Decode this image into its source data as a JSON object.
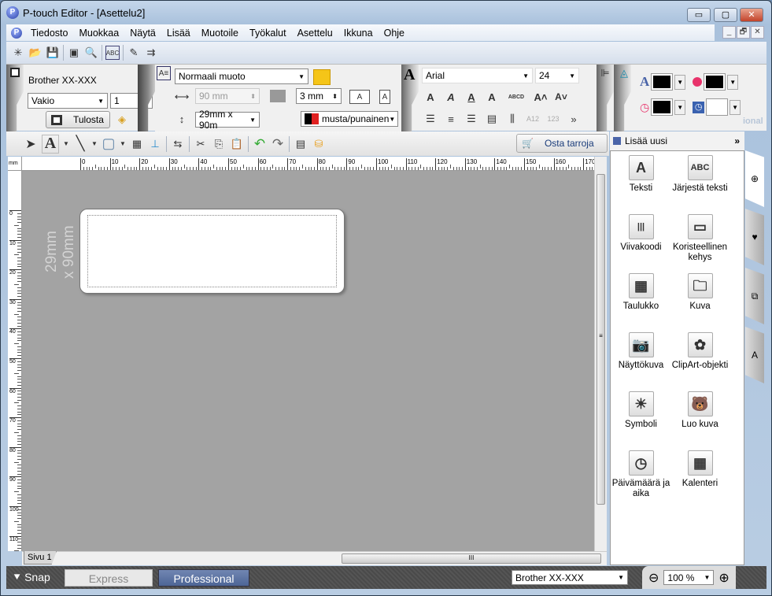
{
  "window": {
    "title": "P-touch Editor - [Asettelu2]",
    "minimize": "▭",
    "maximize": "▢",
    "close": "✕"
  },
  "menu": [
    "Tiedosto",
    "Muokkaa",
    "Näytä",
    "Lisää",
    "Muotoile",
    "Työkalut",
    "Asettelu",
    "Ikkuna",
    "Ohje"
  ],
  "menu_underline": [
    "T",
    "M",
    "N",
    "L",
    "u",
    "y",
    "A",
    "I",
    "O"
  ],
  "mdi": {
    "min": "_",
    "restore": "🗗",
    "close": "✕"
  },
  "printer_group": {
    "printer": "Brother XX-XXX",
    "mode": "Vakio",
    "copies": "1",
    "print_label": "Tulosta"
  },
  "paper_group": {
    "format": "Normaali muoto",
    "length": "90 mm",
    "margin": "3 mm",
    "size": "29mm x 90m",
    "color": "musta/punainen"
  },
  "font_group": {
    "font": "Arial",
    "size": "24"
  },
  "colors": {
    "text": "#000000",
    "fill": "#000000",
    "line": "#000000",
    "background": "#ffffff",
    "accent": "#4a64a8",
    "tape_red": "#e02020"
  },
  "tools": {
    "buy_label": "Osta tarroja"
  },
  "ruler": {
    "unit": "mm",
    "h_ticks": [
      "0",
      "10",
      "20",
      "30",
      "40",
      "50",
      "60",
      "70",
      "80",
      "90",
      "100",
      "110",
      "120",
      "130",
      "140",
      "150",
      "160",
      "170"
    ],
    "v_ticks": [
      "0",
      "10",
      "20",
      "30",
      "40",
      "50",
      "60",
      "70",
      "80",
      "90",
      "100",
      "110"
    ]
  },
  "canvas": {
    "dim_line1": "29mm",
    "dim_line2": "x 90mm",
    "page_tab": "Sivu 1"
  },
  "panel": {
    "title": "Lisää uusi",
    "more": "»",
    "items": [
      {
        "label": "Teksti",
        "glyph": "A"
      },
      {
        "label": "Järjestä teksti",
        "glyph": "ABC"
      },
      {
        "label": "Viivakoodi",
        "glyph": "|||"
      },
      {
        "label": "Koristeellinen kehys",
        "glyph": "▭"
      },
      {
        "label": "Taulukko",
        "glyph": "▦"
      },
      {
        "label": "Kuva",
        "glyph": "🗀"
      },
      {
        "label": "Näyttökuva",
        "glyph": "📷"
      },
      {
        "label": "ClipArt-objekti",
        "glyph": "✿"
      },
      {
        "label": "Symboli",
        "glyph": "☀"
      },
      {
        "label": "Luo kuva",
        "glyph": "🐻"
      },
      {
        "label": "Päivämäärä ja aika",
        "glyph": "◷"
      },
      {
        "label": "Kalenteri",
        "glyph": "▦"
      }
    ]
  },
  "ribbon_watermark": "ional",
  "status": {
    "snap": "Snap",
    "express": "Express",
    "professional": "Professional",
    "printer": "Brother XX-XXX",
    "zoom": "100 %"
  }
}
